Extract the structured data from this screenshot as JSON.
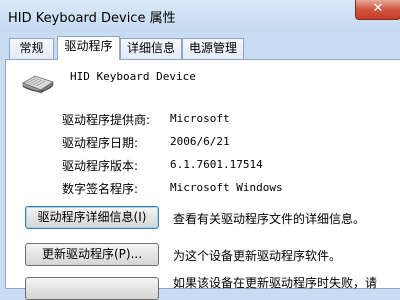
{
  "window": {
    "title": "HID Keyboard Device 属性",
    "close_glyph": "✕"
  },
  "tabs": [
    {
      "label": "常规",
      "active": false
    },
    {
      "label": "驱动程序",
      "active": true
    },
    {
      "label": "详细信息",
      "active": false
    },
    {
      "label": "电源管理",
      "active": false
    }
  ],
  "device": {
    "name": "HID Keyboard Device",
    "icon": "keyboard-icon"
  },
  "properties": [
    {
      "label": "驱动程序提供商:",
      "value": "Microsoft"
    },
    {
      "label": "驱动程序日期:",
      "value": "2006/6/21"
    },
    {
      "label": "驱动程序版本:",
      "value": "6.1.7601.17514"
    },
    {
      "label": "数字签名程序:",
      "value": "Microsoft Windows"
    }
  ],
  "actions": [
    {
      "button": "驱动程序详细信息(I)",
      "description": "查看有关驱动程序文件的详细信息。"
    },
    {
      "button": "更新驱动程序(P)...",
      "description": "为这个设备更新驱动程序软件。"
    },
    {
      "button": "",
      "description": "如果该设备在更新驱动程序时失败，请"
    }
  ],
  "colors": {
    "accent": "#8ea7c6",
    "close": "#c43c23"
  }
}
